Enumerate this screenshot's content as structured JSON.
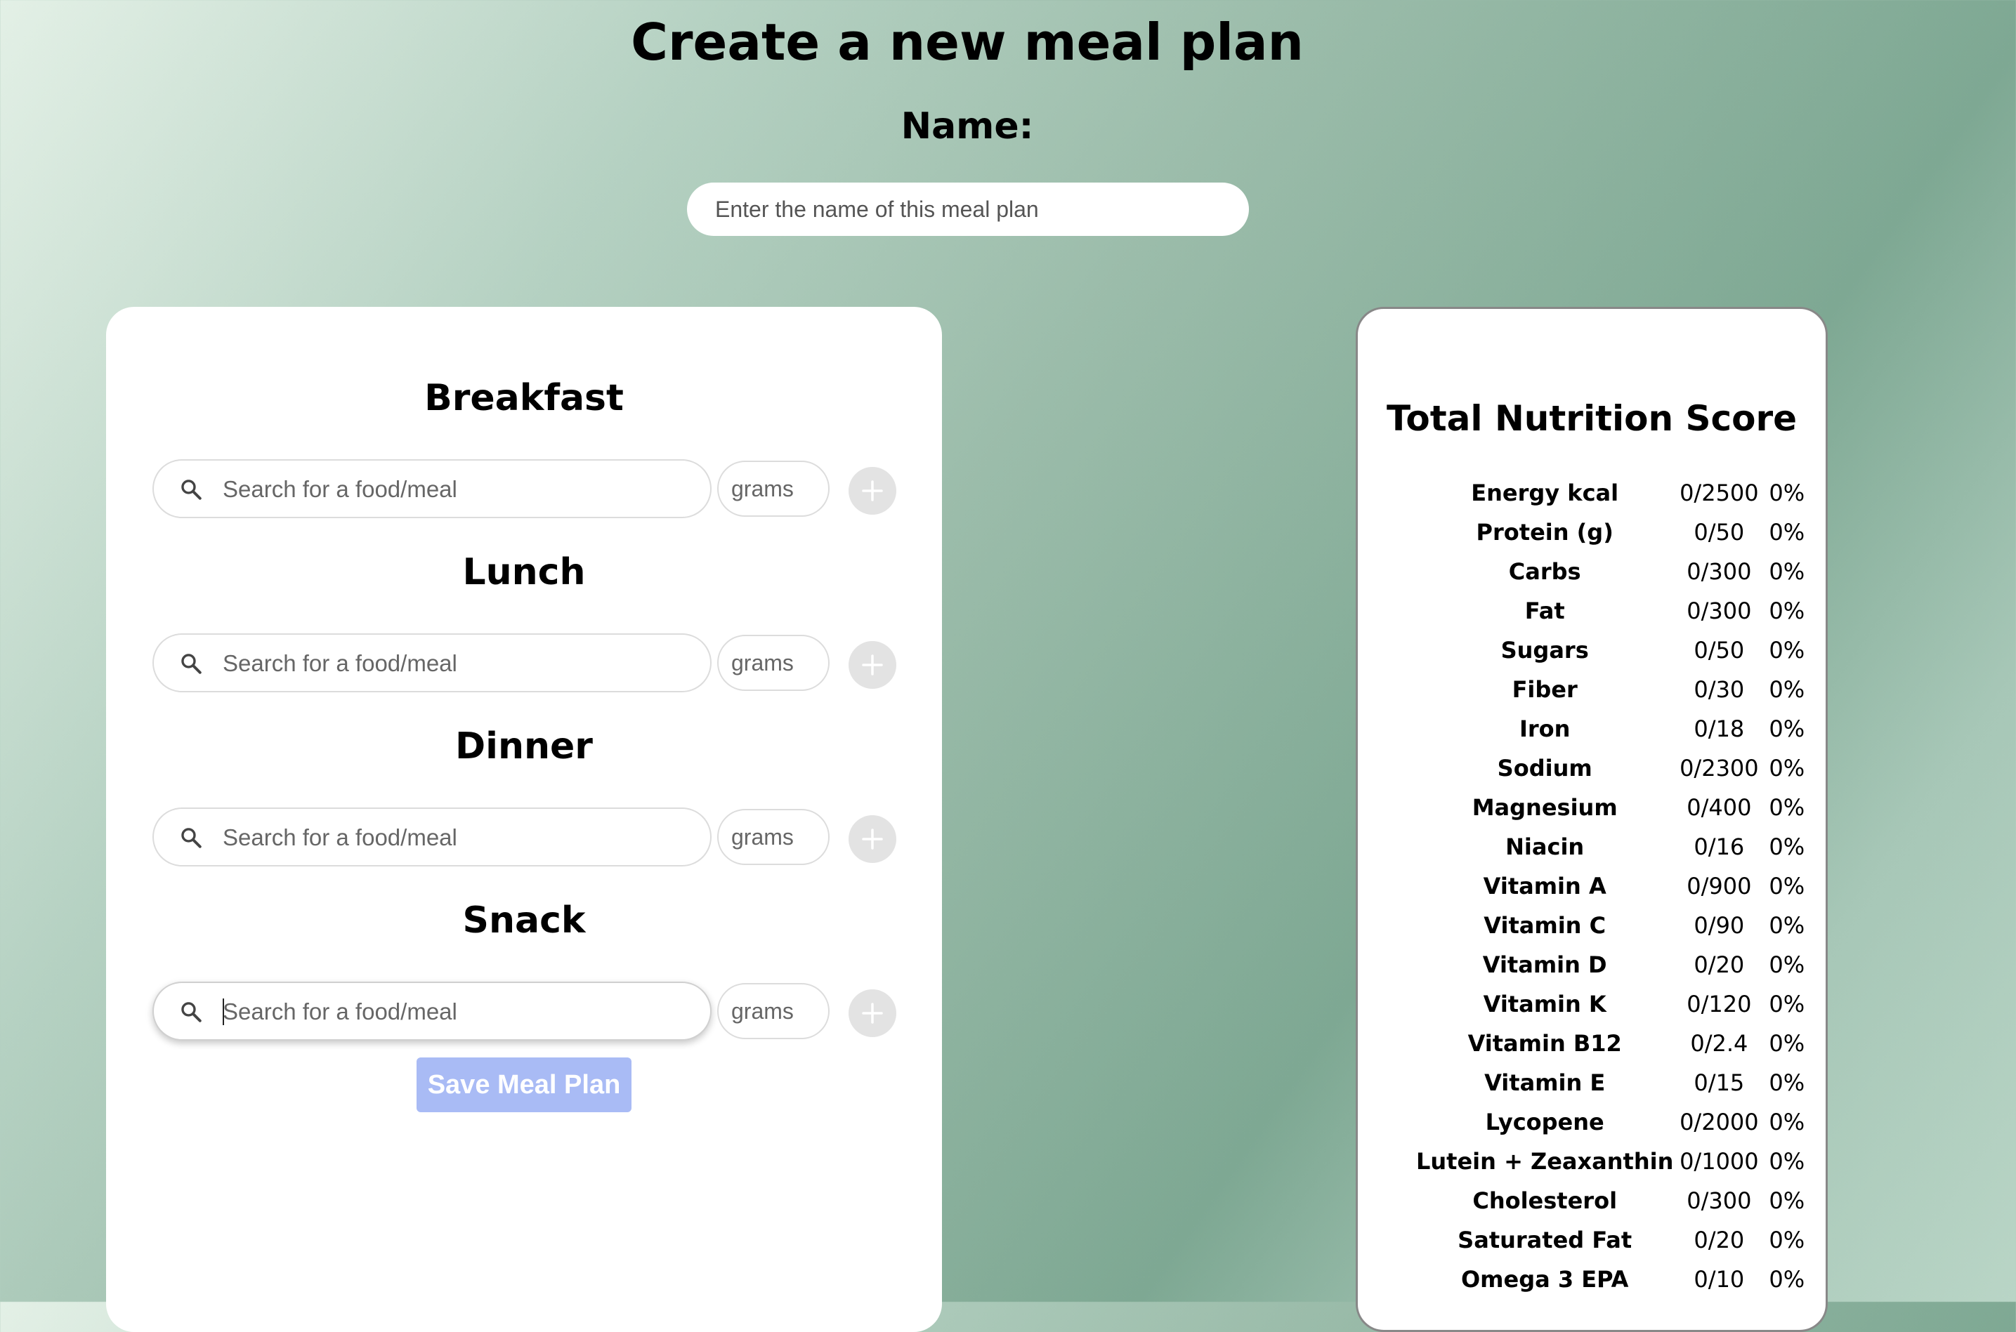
{
  "page": {
    "title": "Create a new meal plan",
    "name_label": "Name:",
    "name_placeholder": "Enter the name of this meal plan"
  },
  "meals": [
    {
      "heading": "Breakfast",
      "search_placeholder": "Search for a food/meal",
      "grams_placeholder": "grams"
    },
    {
      "heading": "Lunch",
      "search_placeholder": "Search for a food/meal",
      "grams_placeholder": "grams"
    },
    {
      "heading": "Dinner",
      "search_placeholder": "Search for a food/meal",
      "grams_placeholder": "grams"
    },
    {
      "heading": "Snack",
      "search_placeholder": "Search for a food/meal",
      "grams_placeholder": "grams"
    }
  ],
  "save_button_label": "Save Meal Plan",
  "nutrition": {
    "title": "Total Nutrition Score",
    "rows": [
      {
        "name": "Energy kcal",
        "value": "0/2500",
        "percent": "0%"
      },
      {
        "name": "Protein (g)",
        "value": "0/50",
        "percent": "0%"
      },
      {
        "name": "Carbs",
        "value": "0/300",
        "percent": "0%"
      },
      {
        "name": "Fat",
        "value": "0/300",
        "percent": "0%"
      },
      {
        "name": "Sugars",
        "value": "0/50",
        "percent": "0%"
      },
      {
        "name": "Fiber",
        "value": "0/30",
        "percent": "0%"
      },
      {
        "name": "Iron",
        "value": "0/18",
        "percent": "0%"
      },
      {
        "name": "Sodium",
        "value": "0/2300",
        "percent": "0%"
      },
      {
        "name": "Magnesium",
        "value": "0/400",
        "percent": "0%"
      },
      {
        "name": "Niacin",
        "value": "0/16",
        "percent": "0%"
      },
      {
        "name": "Vitamin A",
        "value": "0/900",
        "percent": "0%"
      },
      {
        "name": "Vitamin C",
        "value": "0/90",
        "percent": "0%"
      },
      {
        "name": "Vitamin D",
        "value": "0/20",
        "percent": "0%"
      },
      {
        "name": "Vitamin K",
        "value": "0/120",
        "percent": "0%"
      },
      {
        "name": "Vitamin B12",
        "value": "0/2.4",
        "percent": "0%"
      },
      {
        "name": "Vitamin E",
        "value": "0/15",
        "percent": "0%"
      },
      {
        "name": "Lycopene",
        "value": "0/2000",
        "percent": "0%"
      },
      {
        "name": "Lutein + Zeaxanthin",
        "value": "0/1000",
        "percent": "0%"
      },
      {
        "name": "Cholesterol",
        "value": "0/300",
        "percent": "0%"
      },
      {
        "name": "Saturated Fat",
        "value": "0/20",
        "percent": "0%"
      },
      {
        "name": "Omega 3 EPA",
        "value": "0/10",
        "percent": "0%"
      }
    ]
  },
  "colors": {
    "save_button": "#a9bbf5",
    "add_button": "#e3e3e3",
    "card_background": "#ffffff"
  },
  "icons": {
    "search": "search-icon",
    "add": "plus-icon"
  }
}
